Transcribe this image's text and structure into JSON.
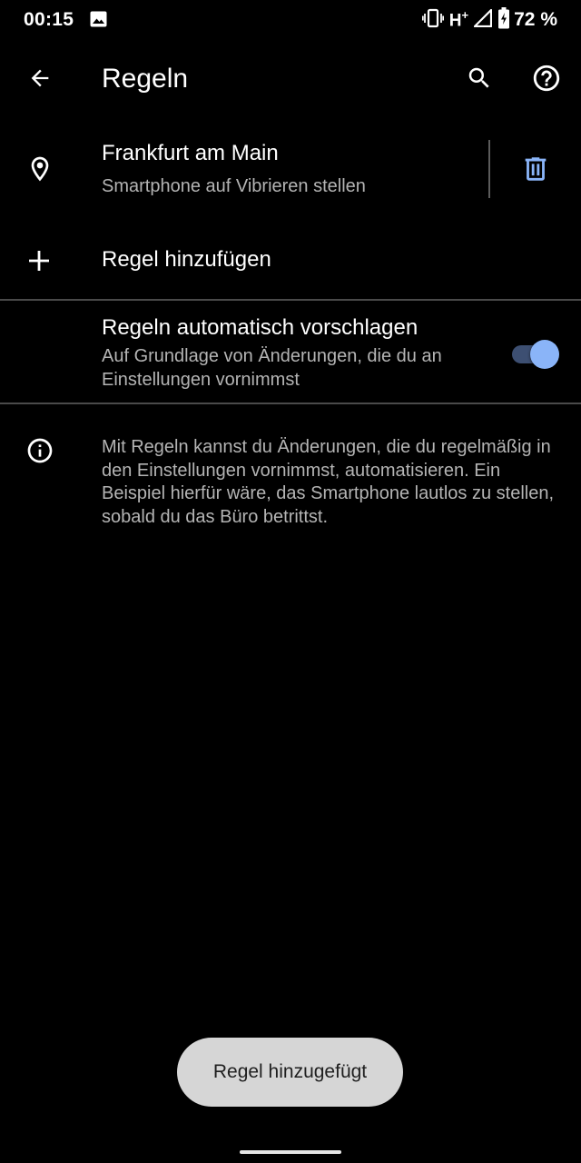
{
  "status_bar": {
    "time": "00:15",
    "network": "H",
    "network_sup": "+",
    "battery_percent": "72 %",
    "icons": [
      "image-notification-icon",
      "vibrate-icon",
      "signal-icon",
      "battery-charging-icon"
    ]
  },
  "app_bar": {
    "title": "Regeln",
    "icons": [
      "back-arrow-icon",
      "search-icon",
      "help-icon"
    ]
  },
  "rule": {
    "title": "Frankfurt am Main",
    "subtitle": "Smartphone auf Vibrieren stellen",
    "icon": "location-pin-icon",
    "delete_icon": "trash-icon"
  },
  "add_rule": {
    "label": "Regel hinzufügen",
    "icon": "plus-icon"
  },
  "suggest": {
    "title": "Regeln automatisch vorschlagen",
    "description": "Auf Grundlage von Änderungen, die du an Einstellungen vornimmst",
    "enabled": true
  },
  "info": {
    "icon": "info-icon",
    "text": "Mit Regeln kannst du Änderungen, die du regelmäßig in den Einstellungen vornimmst, automatisieren. Ein Beispiel hierfür wäre, das Smartphone lautlos zu stellen, sobald du das Büro betrittst."
  },
  "toast": {
    "text": "Regel hinzugefügt"
  },
  "colors": {
    "background": "#000000",
    "accent": "#8ab4f8",
    "toggle_track": "#3d4f72",
    "secondary_text": "#b4b4b4",
    "toast_bg": "#d6d6d6"
  }
}
